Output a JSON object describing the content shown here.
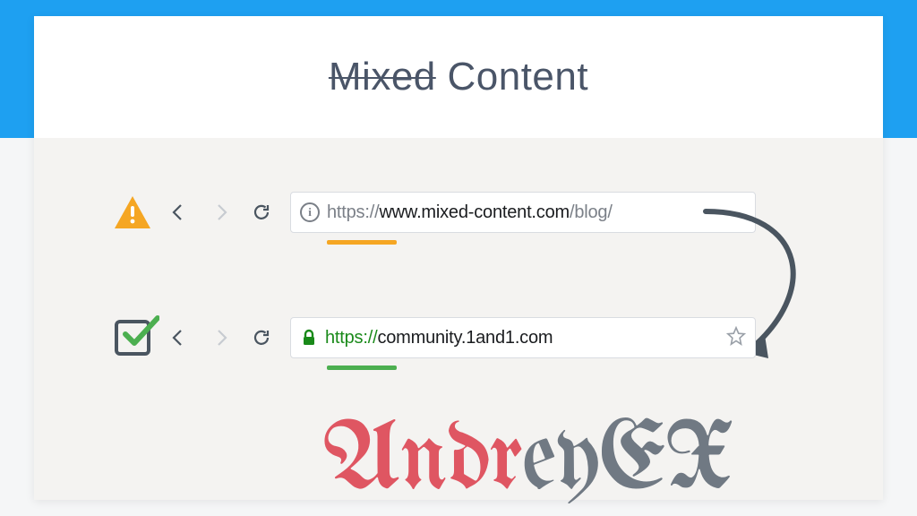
{
  "title": {
    "struck": "Mixed",
    "rest": " Content"
  },
  "row1": {
    "url_scheme": "https://",
    "url_host": "www.mixed-content.com",
    "url_path": "/blog/",
    "info_glyph": "i"
  },
  "row2": {
    "url_scheme": "https://",
    "url_host": "community.1and1.com",
    "url_path": ""
  },
  "watermark": {
    "part_red": "Andr",
    "part_gray": "eyEX"
  }
}
